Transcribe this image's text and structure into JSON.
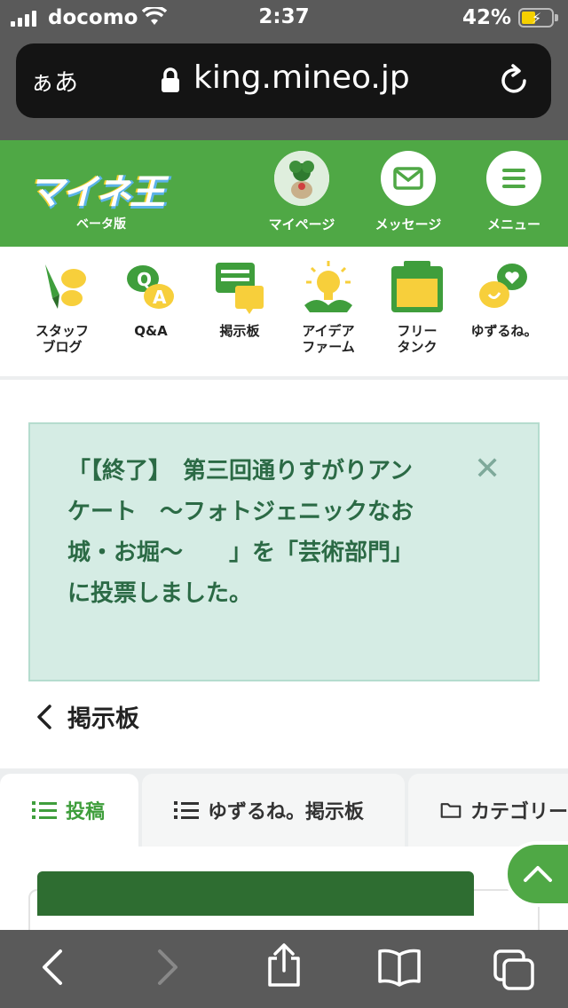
{
  "status": {
    "carrier": "docomo",
    "time": "2:37",
    "battery_pct": "42%"
  },
  "browser": {
    "aa_label": "ぁあ",
    "url": "king.mineo.jp"
  },
  "header": {
    "logo_text": "マイネ王",
    "beta_label": "ベータ版",
    "buttons": [
      {
        "label": "マイページ",
        "icon": "avatar"
      },
      {
        "label": "メッセージ",
        "icon": "envelope-icon"
      },
      {
        "label": "メニュー",
        "icon": "hamburger-icon"
      }
    ]
  },
  "nav": [
    {
      "line1": "スタッフ",
      "line2": "ブログ",
      "icon": "staff-blog-icon"
    },
    {
      "line1": "Q&A",
      "line2": "",
      "icon": "qa-icon"
    },
    {
      "line1": "掲示板",
      "line2": "",
      "icon": "board-icon"
    },
    {
      "line1": "アイデア",
      "line2": "ファーム",
      "icon": "idea-farm-icon"
    },
    {
      "line1": "フリー",
      "line2": "タンク",
      "icon": "free-tank-icon"
    },
    {
      "line1": "ゆずるね。",
      "line2": "",
      "icon": "yuzurune-icon"
    }
  ],
  "notice": {
    "message": "「【終了】　第三回通りすがりアンケート　〜フォトジェニックなお城・お堀〜　　」を「芸術部門」に投票しました。",
    "close_glyph": "✕"
  },
  "back": {
    "label": "掲示板"
  },
  "tabs": [
    {
      "label": "投稿",
      "active": true
    },
    {
      "label": "ゆずるね。掲示板",
      "active": false
    },
    {
      "label": "カテゴリー",
      "active": false
    }
  ],
  "colors": {
    "brand_green": "#4fa845",
    "notice_bg": "#d5ece4",
    "notice_text": "#2b6a45"
  }
}
